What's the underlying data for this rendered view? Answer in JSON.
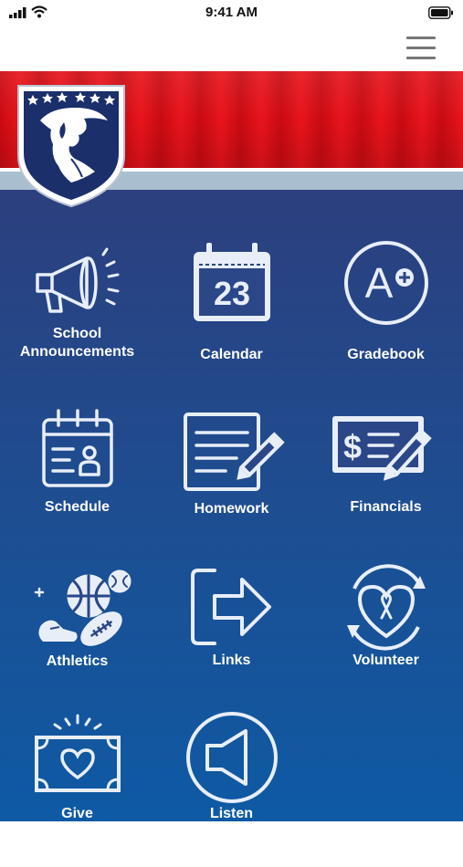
{
  "status": {
    "time": "9:41 AM"
  },
  "tiles": [
    {
      "label": "School Announcements",
      "line1": "School",
      "line2": "Announcements"
    },
    {
      "label": "Calendar",
      "date": "23"
    },
    {
      "label": "Gradebook",
      "grade": "A"
    },
    {
      "label": "Schedule"
    },
    {
      "label": "Homework"
    },
    {
      "label": "Financials"
    },
    {
      "label": "Athletics"
    },
    {
      "label": "Links"
    },
    {
      "label": "Volunteer"
    },
    {
      "label": "Give"
    },
    {
      "label": "Listen"
    }
  ],
  "colors": {
    "banner_red": "#e8141c",
    "stripe": "#a9bfcf",
    "bg_top": "#2c3f7e",
    "bg_bottom": "#0e5aa4",
    "icon": "#e8eef8"
  },
  "icons": [
    "signal-icon",
    "wifi-icon",
    "battery-icon",
    "menu-icon",
    "crest-logo",
    "megaphone-icon",
    "calendar-icon",
    "grade-icon",
    "schedule-icon",
    "homework-icon",
    "check-icon",
    "sports-icon",
    "arrow-icon",
    "heart-ribbon-icon",
    "money-heart-icon",
    "speaker-icon"
  ]
}
